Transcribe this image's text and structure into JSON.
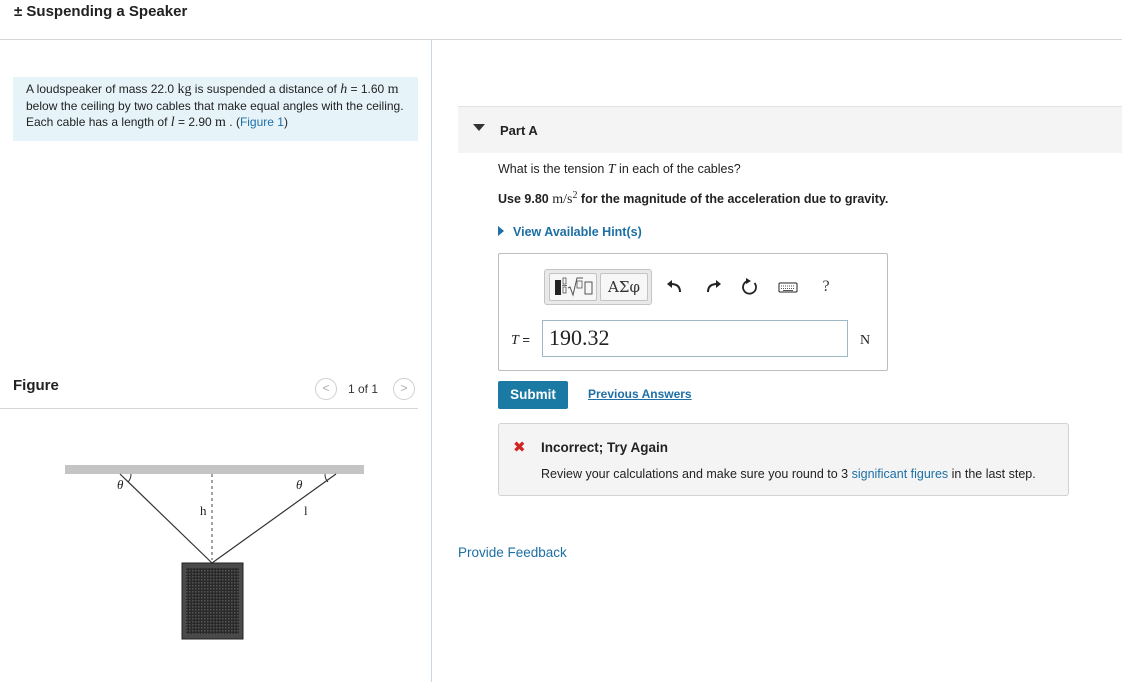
{
  "header": {
    "title": "± Suspending a Speaker"
  },
  "problem": {
    "t1": "A loudspeaker of mass 22.0 ",
    "u1": "kg",
    "t2": " is suspended a distance of ",
    "var_h": "h",
    "t3": " = 1.60 ",
    "u2": "m",
    "t4": " below the ceiling by two cables that make equal angles with the ceiling. Each cable has a length of ",
    "var_l": "l",
    "t5": " = 2.90 ",
    "u3": "m",
    "t6": " . (",
    "figure_link": "Figure 1",
    "t7": ")"
  },
  "figure": {
    "label": "Figure",
    "prev": "<",
    "count": "1 of 1",
    "next": ">",
    "theta_left": "θ",
    "theta_right": "θ",
    "h_label": "h",
    "l_label": "l"
  },
  "part": {
    "title": "Part A",
    "q1": "What is the tension ",
    "q_var": "T",
    "q2": " in each of the cables?",
    "g1": "Use 9.80 ",
    "g_unit": "m/s",
    "g_exp": "2",
    "g2": " for the magnitude of the acceleration due to gravity.",
    "hints": "View Available Hint(s)"
  },
  "toolbar": {
    "greek": "ΑΣφ",
    "help": "?",
    "icons": [
      "templates-icon",
      "greek-symbols-icon",
      "undo-icon",
      "redo-icon",
      "reset-icon",
      "keyboard-icon",
      "help-icon"
    ]
  },
  "answer": {
    "var": "T",
    "eq": " = ",
    "value": "190.32",
    "unit": "N"
  },
  "actions": {
    "submit": "Submit",
    "previous": "Previous Answers"
  },
  "feedback": {
    "icon": "✖",
    "title": "Incorrect; Try Again",
    "m1": "Review your calculations and make sure you round to 3 ",
    "link": "significant figures",
    "m2": " in the last step."
  },
  "provide_feedback": "Provide Feedback",
  "colors": {
    "accent": "#1a7aa4",
    "link": "#1d6fa5",
    "error": "#d22323",
    "problem_bg": "#e6f4fa"
  }
}
